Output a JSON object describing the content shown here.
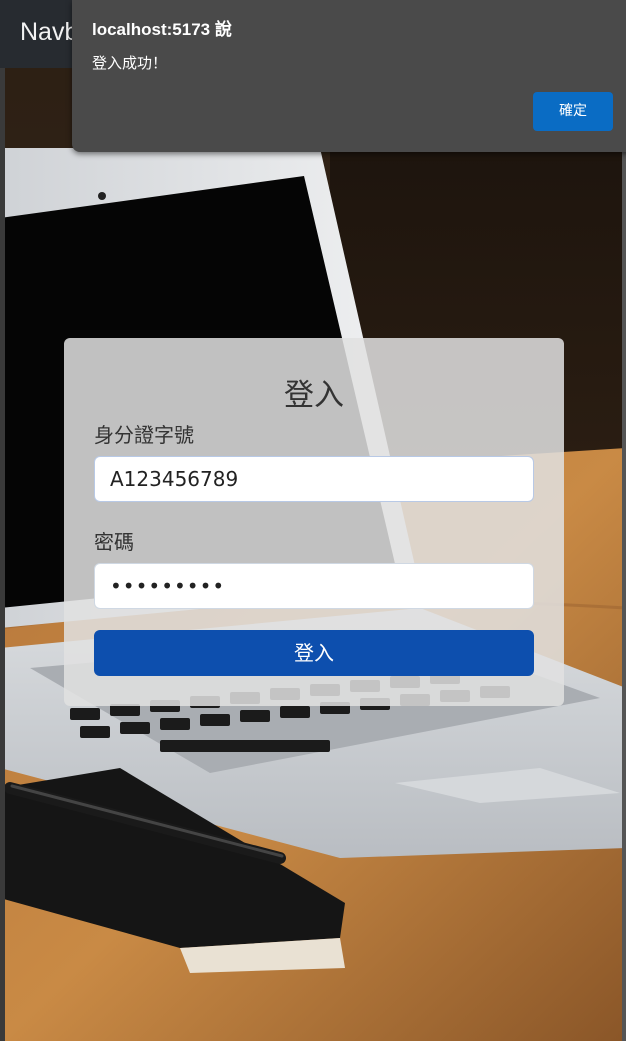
{
  "navbar": {
    "brand": "Navb"
  },
  "dialog": {
    "title": "localhost:5173 說",
    "message": "登入成功！",
    "ok_label": "確定"
  },
  "login": {
    "title": "登入",
    "id_label": "身分證字號",
    "id_value": "A123456789",
    "password_label": "密碼",
    "password_value": "•••••••••",
    "submit_label": "登入"
  },
  "colors": {
    "navbar_bg": "#272b30",
    "dialog_bg": "#4a4a4a",
    "dialog_button": "#0a6cc4",
    "login_button": "#0d4fae"
  }
}
